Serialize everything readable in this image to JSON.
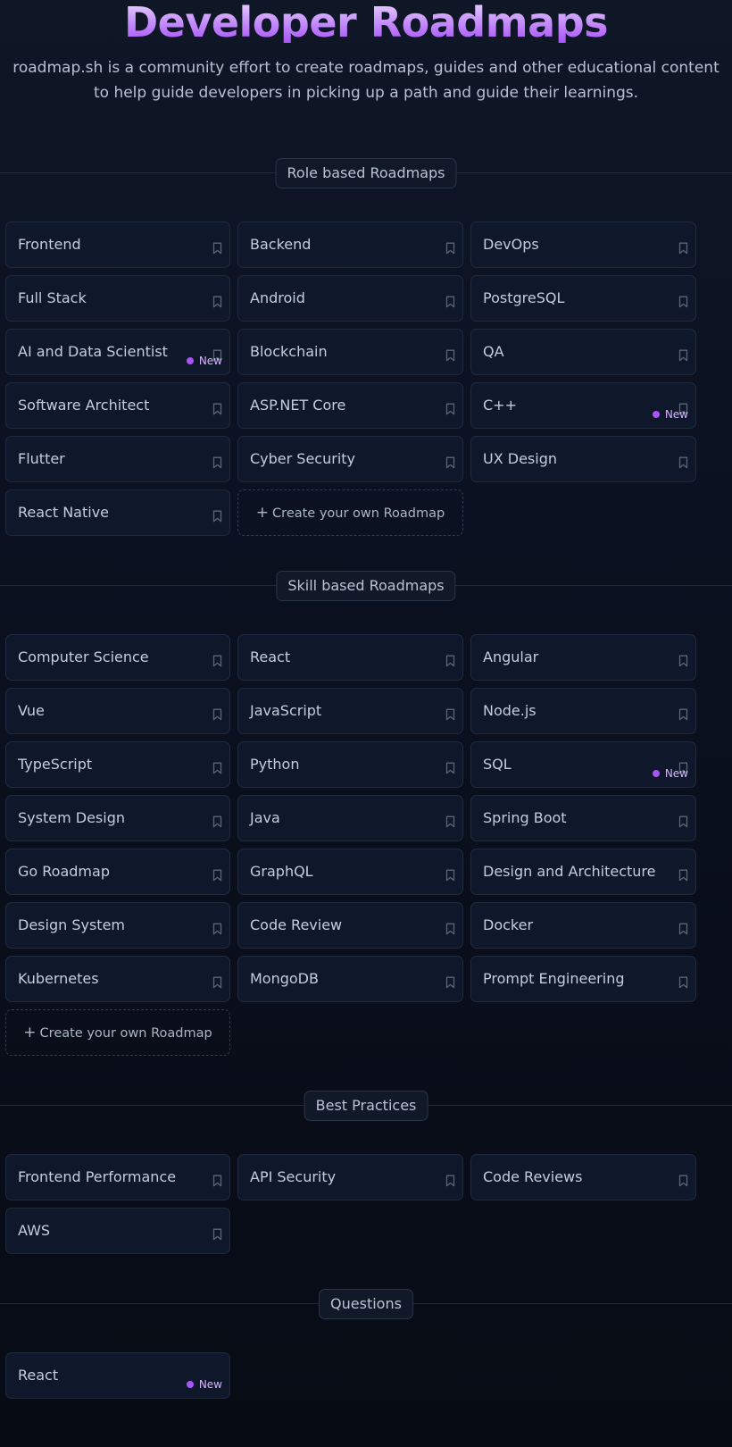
{
  "hero": {
    "title": "Developer Roadmaps",
    "subtitle": "roadmap.sh is a community effort to create roadmaps, guides and other educational content to help guide developers in picking up a path and guide their learnings."
  },
  "new_badge_label": "New",
  "create_label": "Create your own Roadmap",
  "sections": [
    {
      "title": "Role based Roadmaps",
      "items": [
        {
          "label": "Frontend",
          "is_new": false
        },
        {
          "label": "Backend",
          "is_new": false
        },
        {
          "label": "DevOps",
          "is_new": false
        },
        {
          "label": "Full Stack",
          "is_new": false
        },
        {
          "label": "Android",
          "is_new": false
        },
        {
          "label": "PostgreSQL",
          "is_new": false
        },
        {
          "label": "AI and Data Scientist",
          "is_new": true
        },
        {
          "label": "Blockchain",
          "is_new": false
        },
        {
          "label": "QA",
          "is_new": false
        },
        {
          "label": "Software Architect",
          "is_new": false
        },
        {
          "label": "ASP.NET Core",
          "is_new": false
        },
        {
          "label": "C++",
          "is_new": true
        },
        {
          "label": "Flutter",
          "is_new": false
        },
        {
          "label": "Cyber Security",
          "is_new": false
        },
        {
          "label": "UX Design",
          "is_new": false
        },
        {
          "label": "React Native",
          "is_new": false
        }
      ],
      "has_create": true
    },
    {
      "title": "Skill based Roadmaps",
      "items": [
        {
          "label": "Computer Science",
          "is_new": false
        },
        {
          "label": "React",
          "is_new": false
        },
        {
          "label": "Angular",
          "is_new": false
        },
        {
          "label": "Vue",
          "is_new": false
        },
        {
          "label": "JavaScript",
          "is_new": false
        },
        {
          "label": "Node.js",
          "is_new": false
        },
        {
          "label": "TypeScript",
          "is_new": false
        },
        {
          "label": "Python",
          "is_new": false
        },
        {
          "label": "SQL",
          "is_new": true
        },
        {
          "label": "System Design",
          "is_new": false
        },
        {
          "label": "Java",
          "is_new": false
        },
        {
          "label": "Spring Boot",
          "is_new": false
        },
        {
          "label": "Go Roadmap",
          "is_new": false
        },
        {
          "label": "GraphQL",
          "is_new": false
        },
        {
          "label": "Design and Architecture",
          "is_new": false
        },
        {
          "label": "Design System",
          "is_new": false
        },
        {
          "label": "Code Review",
          "is_new": false
        },
        {
          "label": "Docker",
          "is_new": false
        },
        {
          "label": "Kubernetes",
          "is_new": false
        },
        {
          "label": "MongoDB",
          "is_new": false
        },
        {
          "label": "Prompt Engineering",
          "is_new": false
        }
      ],
      "has_create": true
    },
    {
      "title": "Best Practices",
      "items": [
        {
          "label": "Frontend Performance",
          "is_new": false
        },
        {
          "label": "API Security",
          "is_new": false
        },
        {
          "label": "Code Reviews",
          "is_new": false
        },
        {
          "label": "AWS",
          "is_new": false
        }
      ],
      "has_create": false
    },
    {
      "title": "Questions",
      "items": [
        {
          "label": "React",
          "is_new": true,
          "no_bookmark": true
        }
      ],
      "has_create": false
    }
  ],
  "colors": {
    "accent": "#a855f7",
    "badge_text": "#d8b4fe",
    "card_bg": "#0f172a",
    "card_border": "#1f2b40"
  },
  "icons": {
    "bookmark": "bookmark-icon",
    "plus": "plus-icon",
    "new_dot": "new-dot-icon"
  }
}
